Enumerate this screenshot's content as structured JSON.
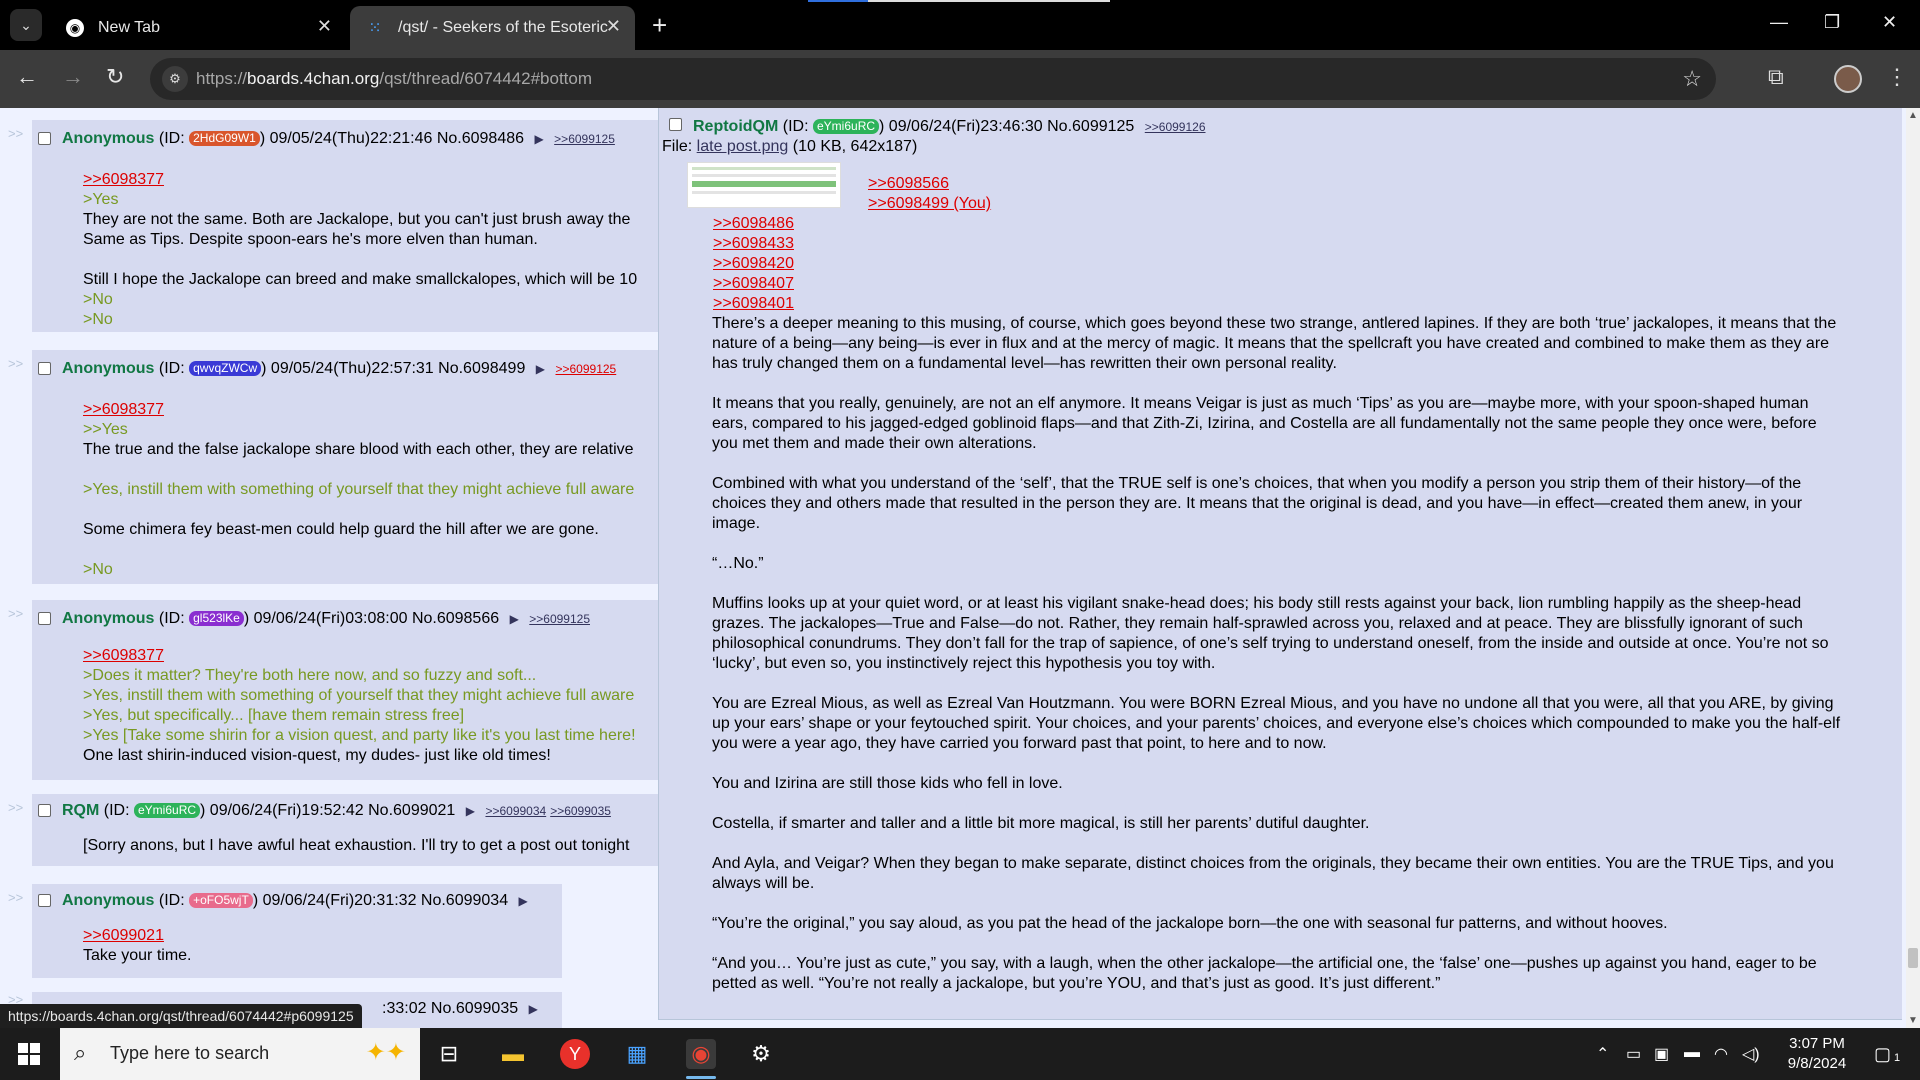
{
  "browser": {
    "tabs": [
      {
        "title": "New Tab"
      },
      {
        "title": "/qst/ - Seekers of the Esoteric: V"
      }
    ],
    "url_prefix": "https://",
    "url_host": "boards.4chan.org",
    "url_path": "/qst/thread/6074442#bottom",
    "status_url": "https://boards.4chan.org/qst/thread/6074442#p6099125"
  },
  "thread": {
    "gt": ">>",
    "posts": [
      {
        "name": "Anonymous",
        "id_label": "(ID: ",
        "id": "2HdG09W1",
        "id_color": "#d9552c",
        "date": ") 09/05/24(Thu)22:21:46 No.6098486",
        "backlinks": [
          ">>6099125"
        ],
        "lines": [
          {
            "t": "ql",
            "text": ">>6098377"
          },
          {
            "t": "gt",
            "text": ">Yes"
          },
          {
            "t": "n",
            "text": "They are not the same. Both are Jackalope, but you can't just brush away the"
          },
          {
            "t": "n",
            "text": "Same as Tips. Despite spoon-ears he's more elven than human."
          },
          {
            "t": "blank",
            "text": ""
          },
          {
            "t": "n",
            "text": "Still I hope the Jackalope can breed and make smallckalopes, which will be 10"
          },
          {
            "t": "gt",
            "text": ">No"
          },
          {
            "t": "gt",
            "text": ">No"
          }
        ]
      },
      {
        "name": "Anonymous",
        "id_label": "(ID: ",
        "id": "qwvqZWCw",
        "id_color": "#3a3ad6",
        "date": ") 09/05/24(Thu)22:57:31 No.6098499",
        "backlinks": [
          ">>6099125"
        ],
        "lines": [
          {
            "t": "ql",
            "text": ">>6098377"
          },
          {
            "t": "gt",
            "text": ">>Yes"
          },
          {
            "t": "n",
            "text": "The true and the false jackalope share blood with each other, they are relative"
          },
          {
            "t": "blank",
            "text": ""
          },
          {
            "t": "gt",
            "text": ">Yes, instill them with something of yourself that they might achieve full aware"
          },
          {
            "t": "blank",
            "text": ""
          },
          {
            "t": "n",
            "text": "Some chimera fey beast-men could help guard the hill after we are gone."
          },
          {
            "t": "blank",
            "text": ""
          },
          {
            "t": "gt",
            "text": ">No"
          }
        ]
      },
      {
        "name": "Anonymous",
        "id_label": "(ID: ",
        "id": "gl523lKe",
        "id_color": "#8a2ed0",
        "date": ") 09/06/24(Fri)03:08:00 No.6098566",
        "backlinks": [
          ">>6099125"
        ],
        "lines": [
          {
            "t": "ql",
            "text": ">>6098377"
          },
          {
            "t": "gt",
            "text": ">Does it matter? They're both here now, and so fuzzy and soft..."
          },
          {
            "t": "gt",
            "text": ">Yes, instill them with something of yourself that they might achieve full aware"
          },
          {
            "t": "gt",
            "text": ">Yes, but specifically... [have them remain stress free]"
          },
          {
            "t": "gt",
            "text": ">Yes [Take some shirin for a vision quest, and party like it's you last time here!"
          },
          {
            "t": "n",
            "text": "One last shirin-induced vision-quest, my dudes- just like old times!"
          }
        ]
      },
      {
        "name": "RQM",
        "id_label": "(ID: ",
        "id": "eYmi6uRC",
        "id_color": "#2db35a",
        "date": ") 09/06/24(Fri)19:52:42 No.6099021",
        "backlinks": [
          ">>6099034",
          ">>6099035"
        ],
        "lines": [
          {
            "t": "n",
            "text": "[Sorry anons, but I have awful heat exhaustion. I'll try to get a post out tonight"
          }
        ]
      },
      {
        "name": "Anonymous",
        "id_label": "(ID: ",
        "id": "+oFO5wjT",
        "id_color": "#e86b8c",
        "date": ") 09/06/24(Fri)20:31:32 No.6099034",
        "backlinks": [],
        "lines": [
          {
            "t": "ql",
            "text": ">>6099021"
          },
          {
            "t": "n",
            "text": "Take your time."
          }
        ]
      },
      {
        "partial_date": ":33:02 No.6099035"
      }
    ],
    "op": {
      "name": "ReptoidQM",
      "id_label": "(ID: ",
      "id": "eYmi6uRC",
      "id_color": "#2db35a",
      "date": ") 09/06/24(Fri)23:46:30 No.6099125",
      "backlink": ">>6099126",
      "file_label": "File: ",
      "file_name": "late post.png",
      "file_meta": " (10 KB, 642x187)",
      "quotes_side": [
        ">>6098566",
        ">>6098499 (You)"
      ],
      "quotes": [
        ">>6098486",
        ">>6098433",
        ">>6098420",
        ">>6098407",
        ">>6098401"
      ],
      "paragraphs": [
        "There’s a deeper meaning to this musing, of course, which goes beyond these two strange, antlered lapines. If they are both ‘true’ jackalopes, it means that the nature of a being—any being—is ever in flux and at the mercy of magic. It means that the spellcraft you have created and combined to make them as they are has truly changed them on a fundamental level—has rewritten their own personal reality.",
        "It means that you really, genuinely, are not an elf anymore. It means Veigar is just as much ‘Tips’ as you are—maybe more, with your spoon-shaped human ears, compared to his jagged-edged goblinoid flaps—and that Zith-Zi, Izirina, and Costella are all fundamentally not the same people they once were, before you met them and made their own alterations.",
        "Combined with what you understand of the ‘self’, that the TRUE self is one’s choices, that when you modify a person you strip them of their history—of the choices they and others made that resulted in the person they are. It means that the original is dead, and you have—in effect—created them anew, in your image.",
        "“…No.”",
        "Muffins looks up at your quiet word, or at least his vigilant snake-head does; his body still rests against your back, lion rumbling happily as the sheep-head grazes. The jackalopes—True and False—do not. Rather, they remain half-sprawled across you, relaxed and at peace. They are blissfully ignorant of such philosophical conundrums. They don’t fall for the trap of sapience, of one’s self trying to understand oneself, from the inside and outside at once. You’re not so ‘lucky’, but even so, you instinctively reject this hypothesis you toy with.",
        "You are Ezreal Mious, as well as Ezreal Van Houtzmann. You were BORN Ezreal Mious, and you have no undone all that you were, all that you ARE, by giving up your ears’ shape or your feytouched spirit. Your choices, and your parents’ choices, and everyone else’s choices which compounded to make you the half-elf you were a year ago, they have carried you forward past that point, to here and to now.",
        "You and Izirina are still those kids who fell in love.",
        "Costella, if smarter and taller and a little bit more magical, is still her parents’ dutiful daughter.",
        "And Ayla, and Veigar? When they began to make separate, distinct choices from the originals, they became their own entities. You are the TRUE Tips, and you always will be.",
        "“You’re the original,” you say aloud, as you pat the head of the jackalope born—the one with seasonal fur patterns, and without hooves.",
        "“And you… You’re just as cute,” you say, with a laugh, when the other jackalope—the artificial one, the ‘false’ one—pushes up against you hand, eager to be petted as well. “You’re not really a jackalope, but you’re YOU, and that’s just as good. It’s just different.”"
      ]
    }
  },
  "taskbar": {
    "search_placeholder": "Type here to search",
    "time": "3:07 PM",
    "date": "9/8/2024",
    "notif_count": "1"
  },
  "icons": {
    "back": "arrow-left-icon",
    "forward": "arrow-right-icon",
    "reload": "reload-icon",
    "star": "star-icon",
    "extensions": "puzzle-icon",
    "menu": "kebab-menu-icon"
  }
}
